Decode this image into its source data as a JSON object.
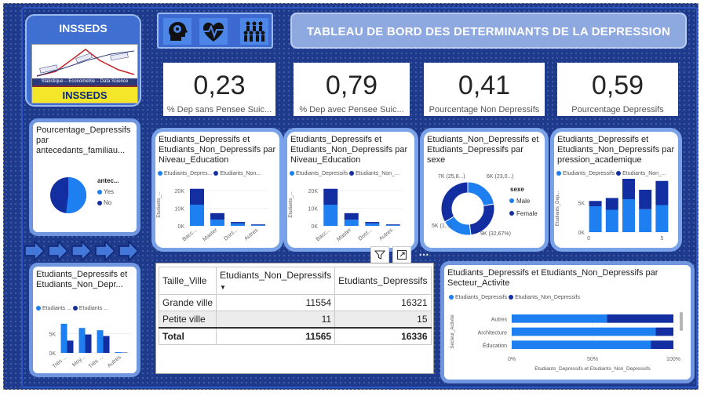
{
  "brand": {
    "title": "INSSEDS",
    "logo_band": "INSSEDS",
    "logo_tag": "Statistique – Econometrie – Data Science"
  },
  "header": {
    "title": "TABLEAU DE BORD DES DETERMINANTS DE LA DEPRESSION"
  },
  "icons": [
    "brain-head-icon",
    "heart-pulse-icon",
    "people-group-icon"
  ],
  "kpis": [
    {
      "value": "0,23",
      "label": "% Dep sans Pensee Suic..."
    },
    {
      "value": "0,79",
      "label": "% Dep avec Pensee Suic..."
    },
    {
      "value": "0,41",
      "label": "Pourcentage Non Depressifs"
    },
    {
      "value": "0,59",
      "label": "Pourcentage Depressifs"
    }
  ],
  "colors": {
    "light_series": "#1e7ff0",
    "dark_series": "#132ea0",
    "background": "#1d3a8c"
  },
  "pie_panel": {
    "title": "Pourcentage_Depressifs par antecedants_familiau...",
    "legend_title": "antec...",
    "legend": [
      "Yes",
      "No"
    ],
    "chart_data": {
      "type": "pie",
      "labels": [
        "Yes",
        "No"
      ],
      "values": [
        52,
        48
      ]
    }
  },
  "left_bars": {
    "title": "Etudiants_Depressifs et Etudiants_Non_Depr...",
    "legend": [
      "Etudiants ...",
      "Etudiants ..."
    ],
    "y_ticks": [
      "5K",
      "0K"
    ],
    "chart_data": {
      "type": "bar",
      "categories": [
        "Très ...",
        "Moy...",
        "Très ...",
        "Autres"
      ],
      "series": [
        {
          "name": "Etudiants_Depressifs",
          "values": [
            7600,
            6500,
            5900,
            200
          ]
        },
        {
          "name": "Etudiants_Non_Depressifs",
          "values": [
            3200,
            4800,
            4400,
            100
          ]
        }
      ],
      "ylim": [
        0,
        9000
      ]
    }
  },
  "edu_chart_1": {
    "title": "Etudiants_Depressifs et Etudiants_Non_Depressifs par Niveau_Education",
    "legend": [
      "Etudiants_Depres...",
      "Etudiants_Non..."
    ],
    "ylabel": "Etudiants_...",
    "y_ticks": [
      "20K",
      "10K",
      "0K"
    ],
    "chart_data": {
      "type": "bar",
      "categories": [
        "Bacc...",
        "Master",
        "Doct...",
        "Autres"
      ],
      "series": [
        {
          "name": "Etudiants_Depressifs",
          "values": [
            12000,
            3500,
            1400,
            400
          ]
        },
        {
          "name": "Etudiants_Non_Depressifs",
          "values": [
            9000,
            3700,
            800,
            400
          ]
        }
      ],
      "ylim": [
        0,
        24000
      ]
    }
  },
  "edu_chart_2": {
    "title": "Etudiants_Depressifs et Etudiants_Non_Depressifs par Niveau_Education",
    "legend": [
      "Etudiants_Depressifs",
      "Etudiants_Non_..."
    ],
    "ylabel": "Etudiants_...",
    "y_ticks": [
      "20K",
      "10K",
      "0K"
    ],
    "chart_data": {
      "type": "bar",
      "categories": [
        "Bacc...",
        "Master",
        "Doct...",
        "Autres"
      ],
      "series": [
        {
          "name": "Etudiants_Depressifs",
          "values": [
            12000,
            3500,
            1400,
            400
          ]
        },
        {
          "name": "Etudiants_Non_Depressifs",
          "values": [
            9000,
            3700,
            800,
            400
          ]
        }
      ],
      "ylim": [
        0,
        24000
      ]
    }
  },
  "sex_donut": {
    "title": "Etudiants_Non_Depressifs et Etudiants_Depressifs par sexe",
    "legend_title": "sexe",
    "legend": [
      "Male",
      "Female"
    ],
    "labels": [
      "7K (25,8...)",
      "6K (23,0...)",
      "5K (1...)",
      "9K (32,67%)"
    ],
    "chart_data": {
      "type": "pie",
      "labels": [
        "Male – Non_Depressifs",
        "Female – Non_Depressifs",
        "Male – Depressifs",
        "Female – Depressifs"
      ],
      "values": [
        6000,
        7000,
        5000,
        9000
      ]
    }
  },
  "pressure_chart": {
    "title": "Etudiants_Depressifs et Etudiants_Non_Depressifs par pression_academique",
    "legend": [
      "Etudiants_Depressifs",
      "Etudiants_Non_..."
    ],
    "ylabel": "Etudiants_Dep...",
    "y_ticks": [
      "5K",
      "0K"
    ],
    "x_ticks": [
      "0",
      "5"
    ],
    "chart_data": {
      "type": "bar",
      "categories": [
        "1",
        "2",
        "3",
        "4",
        "5"
      ],
      "series": [
        {
          "name": "Etudiants_Depressifs",
          "values": [
            4400,
            3800,
            5600,
            3900,
            4600
          ]
        },
        {
          "name": "Etudiants_Non_Depressifs",
          "values": [
            900,
            2000,
            3600,
            3300,
            4100
          ]
        }
      ],
      "ylim": [
        0,
        8000
      ]
    }
  },
  "table": {
    "headers": [
      "Taille_Ville",
      "Etudiants_Non_Depressifs",
      "Etudiants_Depressifs"
    ],
    "rows": [
      [
        "Grande ville",
        "11554",
        "16321"
      ],
      [
        "Petite ville",
        "11",
        "15"
      ]
    ],
    "total": [
      "Total",
      "11565",
      "16336"
    ]
  },
  "sector_chart": {
    "title": "Etudiants_Depressifs et Etudiants_Non_Depressifs par Secteur_Activite",
    "legend": [
      "Etudiants_Depressifs",
      "Etudiants_Non_Depressifs"
    ],
    "ylabel": "Secteur_Activite",
    "xlabel": "Etudiants_Depressifs et Etudiants_Non_Depressifs",
    "x_ticks": [
      "0%",
      "50%",
      "100%"
    ],
    "chart_data": {
      "type": "bar",
      "orientation": "horizontal-100%-stacked",
      "categories": [
        "Autres",
        "Architecture",
        "Éducation"
      ],
      "series": [
        {
          "name": "Etudiants_Depressifs",
          "values": [
            59,
            89,
            86
          ]
        },
        {
          "name": "Etudiants_Non_Depressifs",
          "values": [
            41,
            11,
            14
          ]
        }
      ]
    }
  }
}
